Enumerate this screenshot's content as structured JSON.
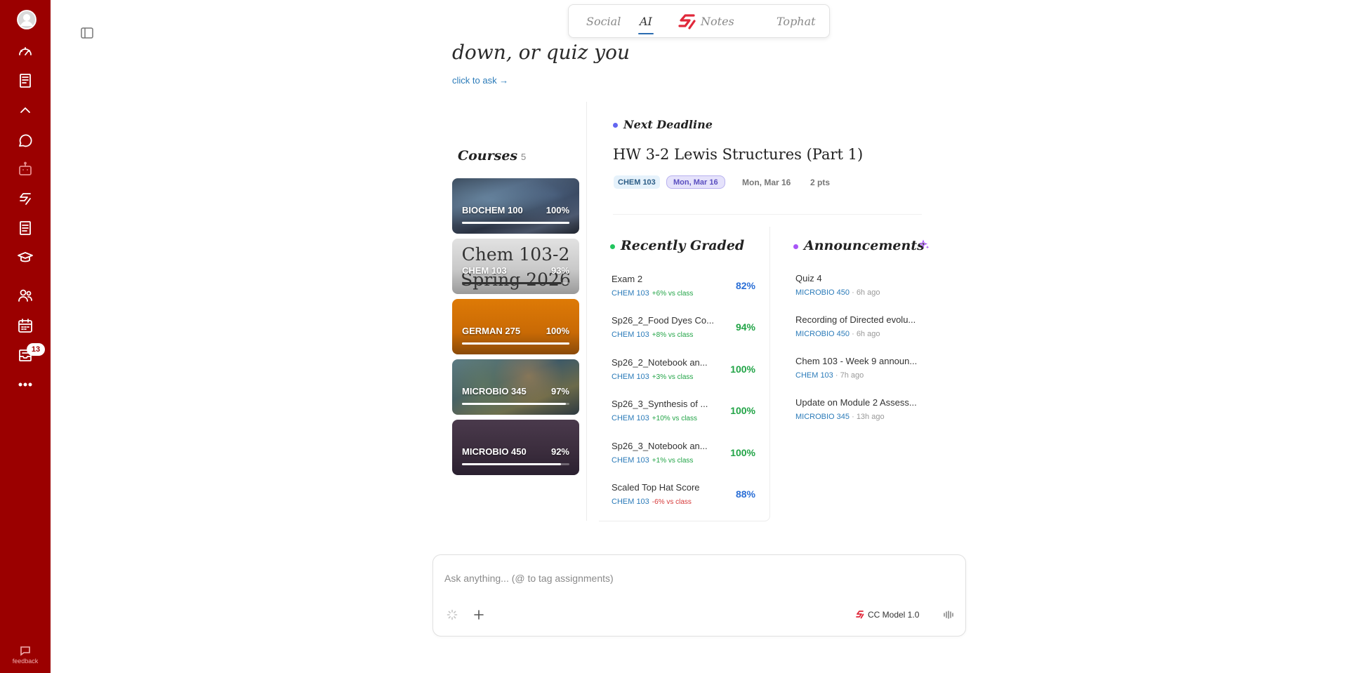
{
  "rail": {
    "badge_count": "13",
    "feedback_label": "feedback",
    "icons": [
      "avatar-icon",
      "dashboard-icon",
      "courses-icon",
      "collapse-icon",
      "chat-icon",
      "bot-icon",
      "cc-logo-icon",
      "document-icon",
      "graduation-cap-icon",
      "people-icon",
      "calendar-icon",
      "inbox-icon",
      "more-icon"
    ]
  },
  "tabs": [
    {
      "label": "Social",
      "active": false
    },
    {
      "label": "AI",
      "active": true
    },
    {
      "label": "Notes",
      "active": false
    },
    {
      "label": "Tophat",
      "active": false
    }
  ],
  "hero": {
    "text": "down, or quiz you",
    "link": "click to ask →"
  },
  "courses": {
    "title": "Courses",
    "count": "5",
    "items": [
      {
        "name": "BIOCHEM 100",
        "pct": "100%",
        "progress": 1.0
      },
      {
        "name": "CHEM 103",
        "pct": "93%",
        "progress": 0.93,
        "overlay_line1": "Chem 103-2",
        "overlay_line2": "Spring 2026"
      },
      {
        "name": "GERMAN 275",
        "pct": "100%",
        "progress": 1.0
      },
      {
        "name": "MICROBIO 345",
        "pct": "97%",
        "progress": 0.97
      },
      {
        "name": "MICROBIO 450",
        "pct": "92%",
        "progress": 0.92
      }
    ]
  },
  "deadline": {
    "label": "Next Deadline",
    "title": "HW 3-2 Lewis Structures (Part 1)",
    "course": "CHEM 103",
    "date_chip": "Mon, Mar 16",
    "date": "Mon, Mar 16",
    "points": "2 pts"
  },
  "recently_graded": {
    "title": "Recently Graded",
    "items": [
      {
        "name": "Exam 2",
        "course": "CHEM 103",
        "delta": "+6% vs class",
        "score": "82%"
      },
      {
        "name": "Sp26_2_Food Dyes Co...",
        "course": "CHEM 103",
        "delta": "+8% vs class",
        "score": "94%"
      },
      {
        "name": "Sp26_2_Notebook an...",
        "course": "CHEM 103",
        "delta": "+3% vs class",
        "score": "100%"
      },
      {
        "name": "Sp26_3_Synthesis of ...",
        "course": "CHEM 103",
        "delta": "+10% vs class",
        "score": "100%"
      },
      {
        "name": "Sp26_3_Notebook an...",
        "course": "CHEM 103",
        "delta": "+1% vs class",
        "score": "100%"
      },
      {
        "name": "Scaled Top Hat Score",
        "course": "CHEM 103",
        "delta": "-6% vs class",
        "score": "88%"
      }
    ]
  },
  "announcements": {
    "title": "Announcements",
    "items": [
      {
        "title": "Quiz 4",
        "course": "MICROBIO 450",
        "time": "6h ago"
      },
      {
        "title": "Recording of Directed evolu...",
        "course": "MICROBIO 450",
        "time": "6h ago"
      },
      {
        "title": "Chem 103 - Week 9 announ...",
        "course": "CHEM 103",
        "time": "7h ago"
      },
      {
        "title": "Update on Module 2 Assess...",
        "course": "MICROBIO 345",
        "time": "13h ago"
      }
    ]
  },
  "ask": {
    "placeholder": "Ask anything... (@ to tag assignments)",
    "model_label": "CC Model 1.0"
  },
  "colors": {
    "rail": "#9b0000",
    "accent_blue": "#2b7bb9",
    "score_green": "#22a447",
    "score_blue": "#2b6fd6",
    "delta_up": "#22a447",
    "delta_down": "#d63a3a",
    "deadline_dot": "#6366f1",
    "graded_dot": "#22c55e",
    "announce_dot": "#a855f7"
  }
}
